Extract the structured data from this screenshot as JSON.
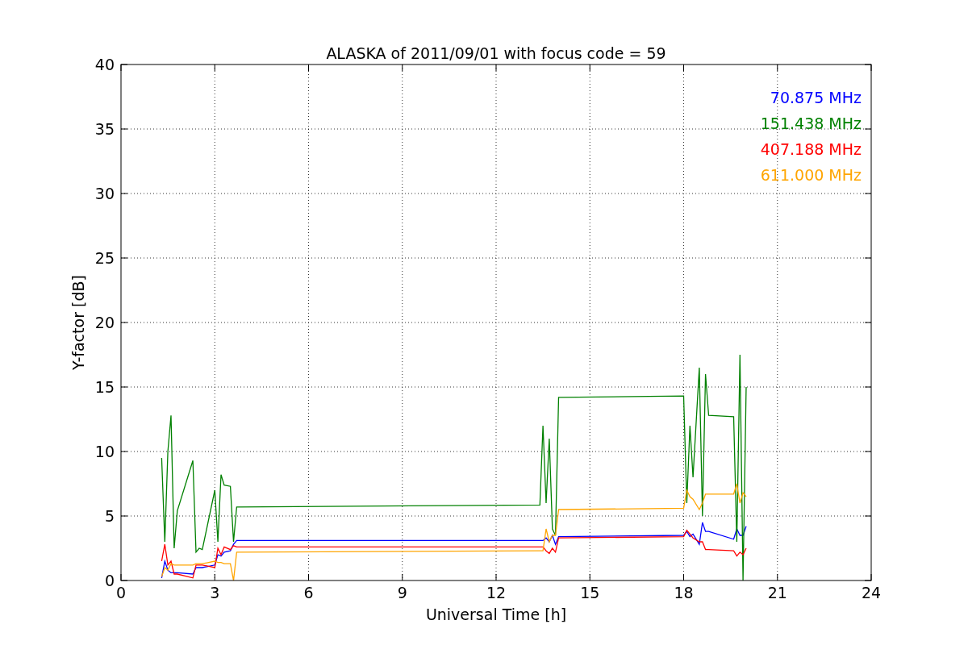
{
  "figure": {
    "chart_data": {
      "type": "line",
      "title": "ALASKA of 2011/09/01 with focus code = 59",
      "xlabel": "Universal Time [h]",
      "ylabel": "Y-factor [dB]",
      "x": [
        1.3,
        1.4,
        1.5,
        1.6,
        1.7,
        1.8,
        2.3,
        2.4,
        2.5,
        2.6,
        3.0,
        3.1,
        3.2,
        3.3,
        3.5,
        3.6,
        3.7,
        13.4,
        13.5,
        13.6,
        13.7,
        13.8,
        13.9,
        14.0,
        18.0,
        18.1,
        18.2,
        18.3,
        18.5,
        18.6,
        18.7,
        18.8,
        19.6,
        19.7,
        19.8,
        19.9,
        20.0
      ],
      "series": [
        {
          "name": "70.875 MHz",
          "color": "#0000ff",
          "values": [
            0.2,
            1.5,
            0.8,
            0.6,
            0.6,
            0.6,
            0.5,
            1.0,
            1.0,
            1.0,
            1.2,
            2.0,
            1.9,
            2.2,
            2.3,
            2.8,
            3.1,
            3.1,
            3.1,
            3.3,
            3.0,
            3.5,
            2.8,
            3.4,
            3.5,
            3.8,
            3.4,
            3.6,
            2.8,
            4.5,
            3.8,
            3.8,
            3.2,
            4.0,
            3.5,
            3.5,
            4.2
          ]
        },
        {
          "name": "151.438 MHz",
          "color": "#008000",
          "values": [
            9.5,
            3,
            10,
            12.8,
            2.5,
            5.4,
            9.3,
            2.2,
            2.5,
            2.4,
            7,
            3,
            8.2,
            7.4,
            7.3,
            3,
            5.7,
            5.85,
            12,
            6,
            11,
            4,
            3.5,
            14.2,
            14.3,
            6,
            12,
            8,
            16.5,
            5,
            16,
            12.8,
            12.7,
            3,
            17.5,
            0,
            15
          ]
        },
        {
          "name": "407.188 MHz",
          "color": "#ff0000",
          "values": [
            1.5,
            2.8,
            1.2,
            1.5,
            0.5,
            0.5,
            0.2,
            1.2,
            1.2,
            1.2,
            1.0,
            2.5,
            2.0,
            2.6,
            2.4,
            2.7,
            2.6,
            2.6,
            2.6,
            2.3,
            2.1,
            2.5,
            2.2,
            3.3,
            3.4,
            3.9,
            3.6,
            3.3,
            3.0,
            3.0,
            2.4,
            2.4,
            2.3,
            1.9,
            2.2,
            2.0,
            2.5
          ]
        },
        {
          "name": "611.000 MHz",
          "color": "#ffa500",
          "values": [
            0.3,
            1.0,
            0.8,
            1.3,
            1.2,
            1.2,
            1.2,
            1.3,
            1.3,
            1.3,
            1.5,
            1.4,
            1.4,
            1.3,
            1.3,
            0,
            2.2,
            2.3,
            2.3,
            4,
            3,
            3.5,
            3.5,
            5.5,
            5.6,
            7,
            6.5,
            6.3,
            5.5,
            6.0,
            6.7,
            6.7,
            6.7,
            7.5,
            6.0,
            6.8,
            6.5
          ]
        }
      ],
      "xlim": [
        0,
        24
      ],
      "ylim": [
        0,
        40
      ],
      "xticks": [
        0,
        3,
        6,
        9,
        12,
        15,
        18,
        21,
        24
      ],
      "yticks": [
        0,
        5,
        10,
        15,
        20,
        25,
        30,
        35,
        40
      ],
      "grid": true
    }
  }
}
